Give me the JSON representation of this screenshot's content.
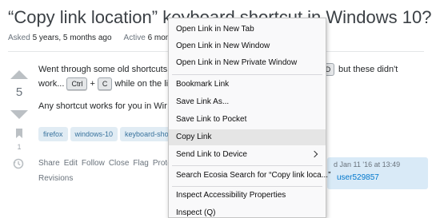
{
  "question": {
    "title": "“Copy link location” keyboard shortcut in Windows 10?",
    "asked_label": "Asked",
    "asked_value": "5 years, 5 months ago",
    "active_label": "Active",
    "active_value": "6 month"
  },
  "post": {
    "vote_count": "5",
    "bookmark_count": "1",
    "line1": "Went through some old shortcuts",
    "line2_prefix": "work...",
    "kbd_ctrl": "Ctrl",
    "kbd_plus": "+",
    "kbd_c": "C",
    "line2_suffix": "while on the lin",
    "kbd_right": "D",
    "right_text": "but these didn't",
    "line3": "Any shortcut works for you in Wir"
  },
  "tags": [
    "firefox",
    "windows-10",
    "keyboard-shor"
  ],
  "actions": {
    "share": "Share",
    "edit": "Edit",
    "follow": "Follow",
    "close": "Close",
    "flag": "Flag",
    "protect": "Protec",
    "revisions": "Revisions"
  },
  "user_card": {
    "date": "d Jan 11 '16 at 13:49",
    "name": "user529857"
  },
  "context_menu": {
    "items": [
      "Open Link in New Tab",
      "Open Link in New Window",
      "Open Link in New Private Window",
      "Bookmark Link",
      "Save Link As...",
      "Save Link to Pocket",
      "Copy Link",
      "Send Link to Device",
      "Search Ecosia Search for “Copy link loca...”",
      "Inspect Accessibility Properties",
      "Inspect (Q)"
    ],
    "highlighted_index": 6
  },
  "colors": {
    "link": "#0077cc",
    "tag_bg": "#e1ecf4",
    "tag_text": "#39739d",
    "menu_bg": "#f9f9fa",
    "menu_highlight": "#e5e5e5"
  }
}
